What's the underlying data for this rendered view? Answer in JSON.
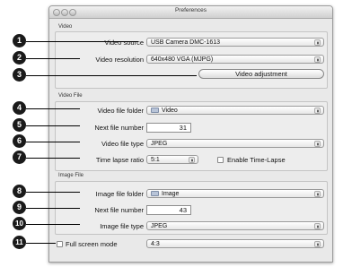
{
  "window": {
    "title": "Preferences"
  },
  "video": {
    "section_title": "Video",
    "source_label": "Video source",
    "source_value": "USB Camera DMC-1613",
    "resolution_label": "Video resolution",
    "resolution_value": "640x480 VGA (MJPG)",
    "adjust_button": "Video adjustment"
  },
  "video_file": {
    "section_title": "Video File",
    "folder_label": "Video file folder",
    "folder_value": "Video",
    "next_label": "Next file number",
    "next_value": "31",
    "type_label": "Video file type",
    "type_value": "JPEG",
    "timelapse_label": "Time lapse ratio",
    "timelapse_value": "5:1",
    "enable_timelapse_label": "Enable Time-Lapse"
  },
  "image_file": {
    "section_title": "Image File",
    "folder_label": "Image file folder",
    "folder_value": "Image",
    "next_label": "Next file number",
    "next_value": "43",
    "type_label": "Image file type",
    "type_value": "JPEG"
  },
  "fullscreen": {
    "label": "Full screen mode",
    "value": "4:3"
  },
  "callouts": [
    "1",
    "2",
    "3",
    "4",
    "5",
    "6",
    "7",
    "8",
    "9",
    "10",
    "11"
  ]
}
